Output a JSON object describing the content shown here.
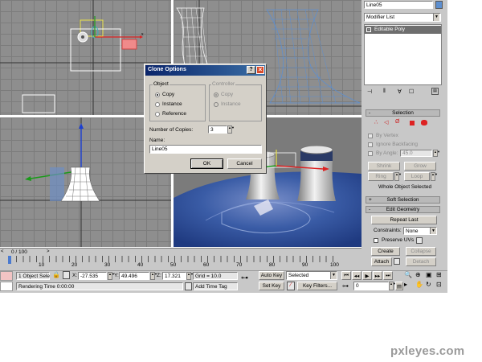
{
  "timeline": {
    "frame_counter": "0 / 100",
    "ticks": [
      "10",
      "20",
      "30",
      "40",
      "50",
      "60",
      "70",
      "80",
      "90",
      "100"
    ]
  },
  "status": {
    "selection": "1 Object Sele",
    "x_label": "X:",
    "x_value": "-27.535",
    "y_label": "Y:",
    "y_value": "49.496",
    "z_label": "Z:",
    "z_value": "17.321",
    "grid": "Grid = 10.0",
    "rendering_time": "Rendering Time  0:00:00",
    "add_time_tag": "Add Time Tag",
    "auto_key": "Auto Key",
    "auto_key_value": "Selected",
    "set_key": "Set Key",
    "key_filters": "Key Filters...",
    "frame_value": "0"
  },
  "command_panel": {
    "object_name": "Line05",
    "modifier_list": "Modifier List",
    "stack_item": "Editable Poly",
    "selection_rollout": "Selection",
    "by_vertex": "By Vertex",
    "ignore_backfacing": "Ignore Backfacing",
    "by_angle": "By Angle:",
    "by_angle_value": "45.0",
    "shrink": "Shrink",
    "grow": "Grow",
    "ring": "Ring",
    "loop": "Loop",
    "selection_status": "Whole Object Selected",
    "soft_selection_rollout": "Soft Selection",
    "edit_geometry_rollout": "Edit Geometry",
    "repeat_last": "Repeat Last",
    "constraints_label": "Constraints:",
    "constraints_value": "None",
    "preserve_uvs": "Preserve UVs",
    "create": "Create",
    "collapse": "Collapse",
    "attach": "Attach",
    "detach": "Detach",
    "rollout_minus": "-",
    "rollout_plus": "+"
  },
  "dialog": {
    "title": "Clone Options",
    "help_button": "?",
    "close_button": "×",
    "object_group": "Object",
    "controller_group": "Controller",
    "object_options": [
      "Copy",
      "Instance",
      "Reference"
    ],
    "controller_options": [
      "Copy",
      "Instance"
    ],
    "copies_label": "Number of Copies:",
    "copies_value": "3",
    "name_label": "Name:",
    "name_value": "Line05",
    "ok": "OK",
    "cancel": "Cancel"
  },
  "watermark": "pxleyes.com",
  "colors": {
    "viewport": "#8e8e8e",
    "grid": "#7c7c7c",
    "dialog_title": "#0a246a",
    "selection_header": "#b9b9b9",
    "wireframe_blue": "#5d8fd0",
    "water": "#2f4f93"
  }
}
